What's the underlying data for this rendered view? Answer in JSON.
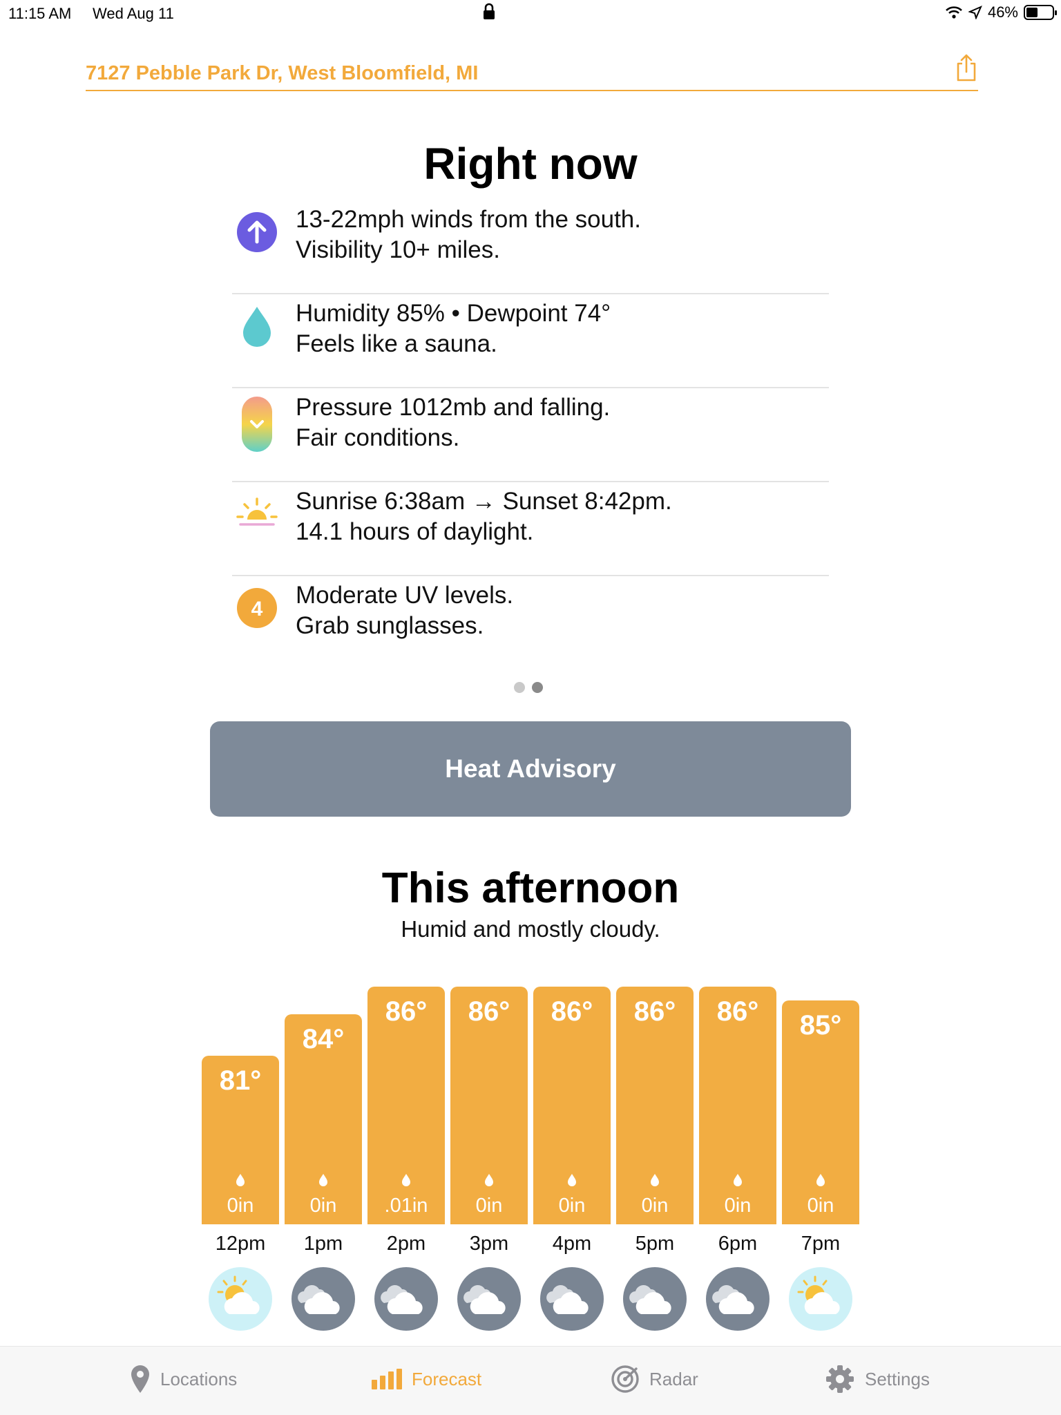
{
  "status_bar": {
    "time": "11:15 AM",
    "date": "Wed Aug 11",
    "battery": "46%",
    "battery_level": 0.46
  },
  "address": {
    "text": "7127 Pebble Park Dr, West Bloomfield, MI"
  },
  "right_now": {
    "title": "Right now",
    "rows": [
      {
        "icon": "wind-arrow-icon",
        "line1": "13-22mph winds from the south.",
        "line2": "Visibility 10+ miles."
      },
      {
        "icon": "humidity-drop-icon",
        "line1": "Humidity 85% • Dewpoint 74°",
        "line2": "Feels like a sauna."
      },
      {
        "icon": "pressure-falling-icon",
        "line1": "Pressure 1012mb and falling.",
        "line2": "Fair conditions."
      },
      {
        "icon": "sunrise-icon",
        "line1": "Sunrise 6:38am → Sunset 8:42pm.",
        "line2": "14.1 hours of daylight."
      },
      {
        "icon": "uv-index-icon",
        "uv_value": "4",
        "line1": "Moderate UV levels.",
        "line2": "Grab sunglasses."
      }
    ]
  },
  "advisory": {
    "label": "Heat Advisory"
  },
  "afternoon": {
    "title": "This afternoon",
    "subtitle": "Humid and mostly cloudy."
  },
  "hourly": [
    {
      "time": "12pm",
      "temp": "81°",
      "temp_value": 81,
      "precip": "0in",
      "icon": "partly-sunny-icon"
    },
    {
      "time": "1pm",
      "temp": "84°",
      "temp_value": 84,
      "precip": "0in",
      "icon": "cloudy-icon"
    },
    {
      "time": "2pm",
      "temp": "86°",
      "temp_value": 86,
      "precip": ".01in",
      "icon": "cloudy-icon"
    },
    {
      "time": "3pm",
      "temp": "86°",
      "temp_value": 86,
      "precip": "0in",
      "icon": "cloudy-icon"
    },
    {
      "time": "4pm",
      "temp": "86°",
      "temp_value": 86,
      "precip": "0in",
      "icon": "cloudy-icon"
    },
    {
      "time": "5pm",
      "temp": "86°",
      "temp_value": 86,
      "precip": "0in",
      "icon": "cloudy-icon"
    },
    {
      "time": "6pm",
      "temp": "86°",
      "temp_value": 86,
      "precip": "0in",
      "icon": "cloudy-icon"
    },
    {
      "time": "7pm",
      "temp": "85°",
      "temp_value": 85,
      "precip": "0in",
      "icon": "partly-sunny-icon"
    }
  ],
  "tabs": [
    {
      "label": "Locations",
      "icon": "location-pin-icon",
      "active": false
    },
    {
      "label": "Forecast",
      "icon": "bar-chart-icon",
      "active": true
    },
    {
      "label": "Radar",
      "icon": "radar-icon",
      "active": false
    },
    {
      "label": "Settings",
      "icon": "gear-icon",
      "active": false
    }
  ],
  "colors": {
    "accent": "#f2a93b",
    "bar": "#f2ad42",
    "advisory": "#7e8a99",
    "wind": "#6b5ce0",
    "humidity": "#5cc9cf",
    "uv": "#f2a93b"
  }
}
